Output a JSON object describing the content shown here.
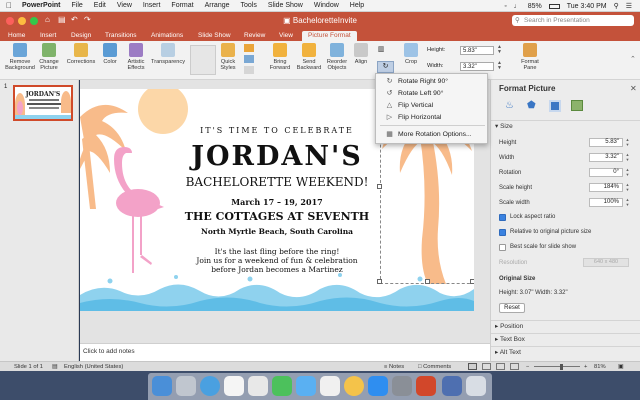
{
  "menubar": {
    "app": "PowerPoint",
    "items": [
      "File",
      "Edit",
      "View",
      "Insert",
      "Format",
      "Arrange",
      "Tools",
      "Slide Show",
      "Window",
      "Help"
    ],
    "battery": "85%",
    "clock": "Tue 3:40 PM"
  },
  "window": {
    "title": "BacheloretteInvite",
    "search_placeholder": "Search in Presentation"
  },
  "tabs": [
    "Home",
    "Insert",
    "Design",
    "Transitions",
    "Animations",
    "Slide Show",
    "Review",
    "View",
    "Picture Format"
  ],
  "active_tab": "Picture Format",
  "ribbon": {
    "remove_background": "Remove Background",
    "change_picture": "Change Picture",
    "corrections": "Corrections",
    "color": "Color",
    "artistic_effects": "Artistic Effects",
    "transparency": "Transparency",
    "quick_styles": "Quick Styles",
    "bring_forward": "Bring Forward",
    "send_backward": "Send Backward",
    "reorder_objects": "Reorder Objects",
    "align": "Align",
    "crop": "Crop",
    "height_label": "Height:",
    "height_value": "5.83\"",
    "width_label": "Width:",
    "width_value": "3.32\"",
    "format_pane": "Format Pane"
  },
  "rotate_menu": {
    "items": [
      "Rotate Right 90°",
      "Rotate Left 90°",
      "Flip Vertical",
      "Flip Horizontal",
      "More Rotation Options..."
    ],
    "icons": [
      "rotate-right-icon",
      "rotate-left-icon",
      "flip-vertical-icon",
      "flip-horizontal-icon",
      "rotation-options-icon"
    ]
  },
  "slide": {
    "number": "1",
    "thumb_title": "JORDAN'S",
    "line1": "IT'S TIME TO CELEBRATE",
    "name": "JORDAN'S",
    "headline": "BACHELORETTE WEEKEND!",
    "dates": "March 17 – 19, 2017",
    "venue": "THE COTTAGES AT SEVENTH",
    "location": "North Myrtle Beach, South Carolina",
    "body1": "It's the last fling before the ring!",
    "body2": "Join us for a weekend of fun & celebration",
    "body3": "before Jordan becomes a Martinez"
  },
  "notes_placeholder": "Click to add notes",
  "format_pane": {
    "title": "Format Picture",
    "section_size": "Size",
    "height_label": "Height",
    "height_value": "5.83\"",
    "width_label": "Width",
    "width_value": "3.32\"",
    "rotation_label": "Rotation",
    "rotation_value": "0°",
    "scale_height_label": "Scale height",
    "scale_height_value": "184%",
    "scale_width_label": "Scale width",
    "scale_width_value": "100%",
    "lock_aspect": "Lock aspect ratio",
    "relative_original": "Relative to original picture size",
    "best_scale": "Best scale for slide show",
    "resolution_label": "Resolution",
    "resolution_value": "640 x 480",
    "original_size": "Original Size",
    "original_dims": "Height:  3.07\"   Width:  3.32\"",
    "reset": "Reset",
    "section_position": "Position",
    "section_textbox": "Text Box",
    "section_alttext": "Alt Text"
  },
  "status": {
    "slide_count": "Slide 1 of 1",
    "language": "English (United States)",
    "notes": "Notes",
    "comments": "Comments",
    "zoom": "81%"
  },
  "colors": {
    "accent": "#c4523a",
    "flamingo": "#f3a2c8",
    "palm": "#f8bb8a",
    "water": "#8fd2ee"
  }
}
